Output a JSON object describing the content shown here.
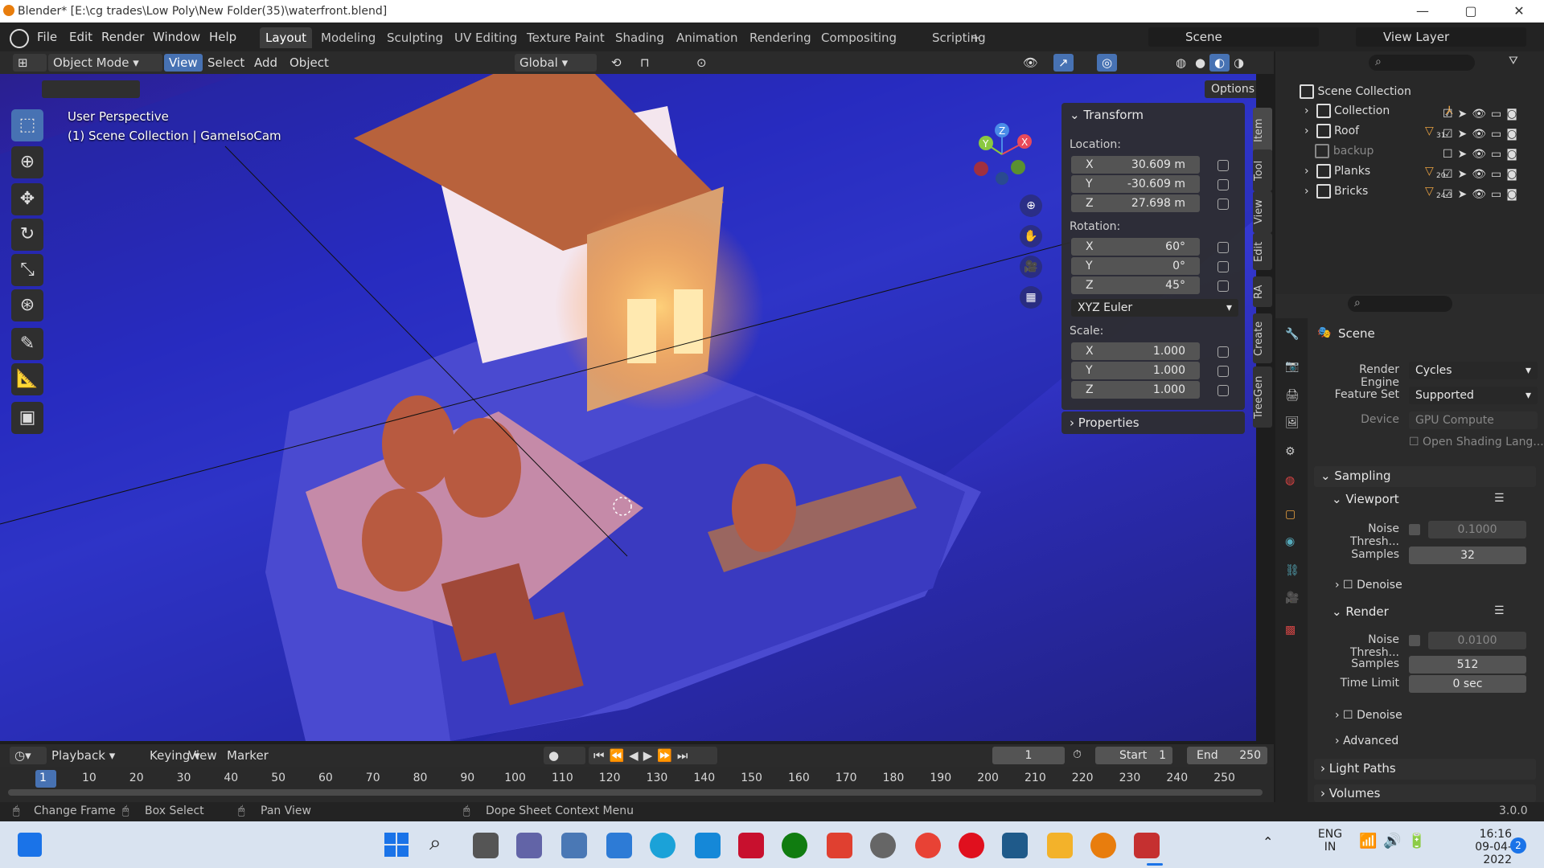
{
  "title_bar": {
    "title": "Blender* [E:\\cg trades\\Low Poly\\New Folder(35)\\waterfront.blend]",
    "minimize": "—",
    "maximize": "▢",
    "close": "✕"
  },
  "menu": [
    "File",
    "Edit",
    "Render",
    "Window",
    "Help"
  ],
  "workspaces": [
    "Layout",
    "Modeling",
    "Sculpting",
    "UV Editing",
    "Texture Paint",
    "Shading",
    "Animation",
    "Rendering",
    "Compositing",
    "Scripting",
    "+"
  ],
  "scene_selector": "Scene",
  "view_layer": "View Layer",
  "viewport_header": {
    "mode": "Object Mode",
    "view": "View",
    "select": "Select",
    "add": "Add",
    "object": "Object",
    "orientation": "Global",
    "options": "Options"
  },
  "viewport": {
    "perspective": "User Perspective",
    "collection_info": "(1) Scene Collection | GameIsoCam"
  },
  "gizmo": {
    "x": "X",
    "y": "Y",
    "z": "Z"
  },
  "transform": {
    "title": "Transform",
    "location_label": "Location:",
    "location": [
      {
        "axis": "X",
        "value": "30.609 m"
      },
      {
        "axis": "Y",
        "value": "-30.609 m"
      },
      {
        "axis": "Z",
        "value": "27.698 m"
      }
    ],
    "rotation_label": "Rotation:",
    "rotation": [
      {
        "axis": "X",
        "value": "60°"
      },
      {
        "axis": "Y",
        "value": "0°"
      },
      {
        "axis": "Z",
        "value": "45°"
      }
    ],
    "rotation_mode": "XYZ Euler",
    "scale_label": "Scale:",
    "scale": [
      {
        "axis": "X",
        "value": "1.000"
      },
      {
        "axis": "Y",
        "value": "1.000"
      },
      {
        "axis": "Z",
        "value": "1.000"
      }
    ],
    "properties": "Properties"
  },
  "side_tabs": [
    "Item",
    "Tool",
    "View",
    "Edit",
    "RA",
    "Create",
    "TreeGen"
  ],
  "outliner": {
    "root": "Scene Collection",
    "items": [
      {
        "name": "Collection",
        "badge": ""
      },
      {
        "name": "Roof",
        "badge": "31"
      },
      {
        "name": "backup",
        "badge": ""
      },
      {
        "name": "Planks",
        "badge": "20"
      },
      {
        "name": "Bricks",
        "badge": "24 3"
      }
    ]
  },
  "properties": {
    "context": "Scene",
    "render_engine_label": "Render Engine",
    "render_engine": "Cycles",
    "feature_set_label": "Feature Set",
    "feature_set": "Supported",
    "device_label": "Device",
    "device": "GPU Compute",
    "osl": "Open Shading Lang...",
    "sampling": "Sampling",
    "viewport_section": "Viewport",
    "noise_threshold_label": "Noise Thresh...",
    "viewport_noise": "0.1000",
    "samples_label": "Samples",
    "viewport_samples": "32",
    "denoise": "Denoise",
    "render_section": "Render",
    "render_noise": "0.0100",
    "render_samples": "512",
    "time_limit_label": "Time Limit",
    "time_limit": "0 sec",
    "advanced": "Advanced",
    "light_paths": "Light Paths",
    "volumes": "Volumes"
  },
  "timeline": {
    "playback": "Playback",
    "keying": "Keying",
    "view": "View",
    "marker": "Marker",
    "current_frame": "1",
    "start_label": "Start",
    "start": "1",
    "end_label": "End",
    "end": "250",
    "ticks": [
      "1",
      "10",
      "20",
      "30",
      "40",
      "50",
      "60",
      "70",
      "80",
      "90",
      "100",
      "110",
      "120",
      "130",
      "140",
      "150",
      "160",
      "170",
      "180",
      "190",
      "200",
      "210",
      "220",
      "230",
      "240",
      "250"
    ]
  },
  "status_bar": {
    "change_frame": "Change Frame",
    "box_select": "Box Select",
    "pan_view": "Pan View",
    "context_menu": "Dope Sheet Context Menu",
    "version": "3.0.0"
  },
  "taskbar": {
    "lang": "ENG",
    "region": "IN",
    "time": "16:16",
    "date": "09-04-2022",
    "notif": "2"
  }
}
